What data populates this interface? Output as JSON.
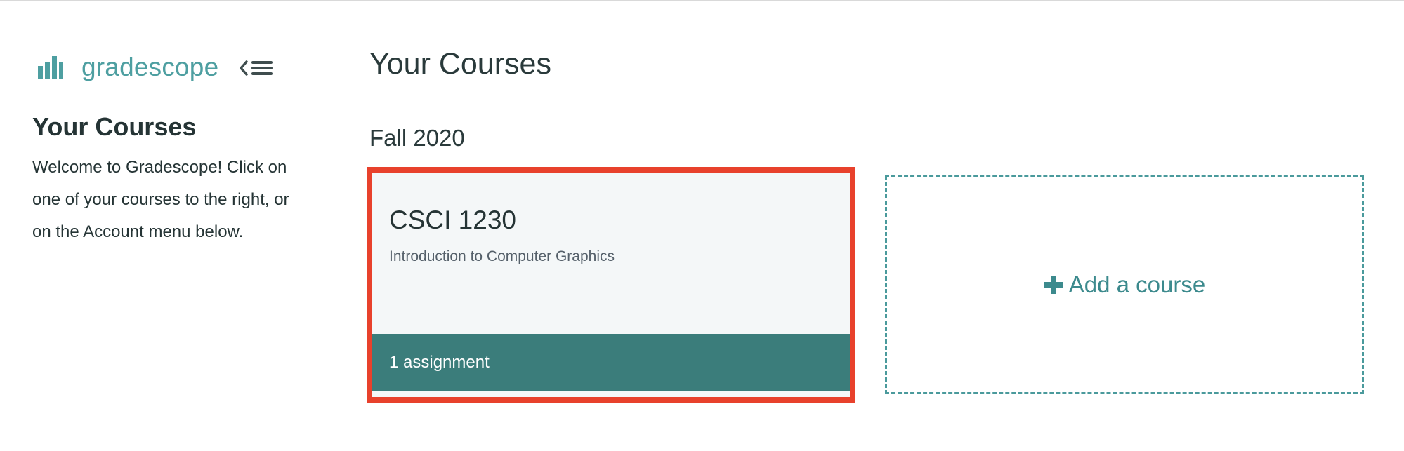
{
  "brand": {
    "name": "gradescope",
    "logo_icon": "bar-chart-logo-icon",
    "accent_color": "#4e9fa1"
  },
  "sidebar": {
    "collapse_icon": "collapse-menu-icon",
    "title": "Your Courses",
    "welcome_text": "Welcome to Gradescope! Click on one of your courses to the right, or on the Account menu below."
  },
  "main": {
    "title": "Your Courses",
    "terms": [
      {
        "name": "Fall 2020",
        "courses": [
          {
            "code": "CSCI 1230",
            "name": "Introduction to Computer Graphics",
            "assignments": "1 assignment",
            "footer_color": "#3b7d7b",
            "highlight_color": "#e8412c"
          }
        ]
      }
    ],
    "add_course": {
      "icon": "plus-icon",
      "label": "Add a course"
    }
  }
}
